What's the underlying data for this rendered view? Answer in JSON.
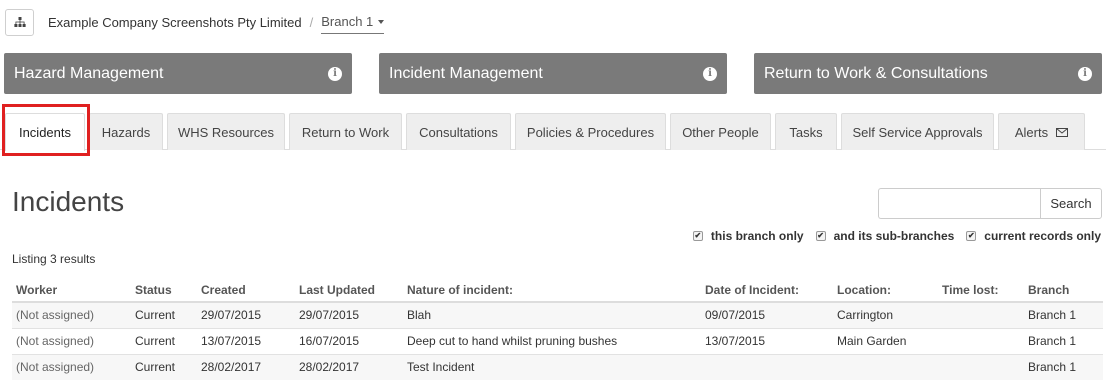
{
  "breadcrumb": {
    "company": "Example Company Screenshots Pty Limited",
    "separator": "/",
    "branch": "Branch 1"
  },
  "modules": [
    {
      "label": "Hazard Management",
      "icon": "info-icon"
    },
    {
      "label": "Incident Management",
      "icon": "info-icon"
    },
    {
      "label": "Return to Work & Consultations",
      "icon": "info-icon"
    }
  ],
  "tabs": [
    {
      "label": "Incidents",
      "active": true
    },
    {
      "label": "Hazards"
    },
    {
      "label": "WHS Resources"
    },
    {
      "label": "Return to Work"
    },
    {
      "label": "Consultations"
    },
    {
      "label": "Policies & Procedures"
    },
    {
      "label": "Other People"
    },
    {
      "label": "Tasks"
    },
    {
      "label": "Self Service Approvals"
    },
    {
      "label": "Alerts",
      "icon": "envelope-icon"
    }
  ],
  "main": {
    "title": "Incidents",
    "search": {
      "placeholder": "",
      "button": "Search"
    },
    "filters": [
      {
        "label": "this branch only",
        "checked": true
      },
      {
        "label": "and its sub-branches",
        "checked": true
      },
      {
        "label": "current records only",
        "checked": true
      }
    ],
    "listing": "Listing 3 results"
  },
  "table": {
    "columns": [
      "Worker",
      "Status",
      "Created",
      "Last Updated",
      "Nature of incident:",
      "Date of Incident:",
      "Location:",
      "Time lost:",
      "Branch"
    ],
    "rows": [
      [
        "(Not assigned)",
        "Current",
        "29/07/2015",
        "29/07/2015",
        "Blah",
        "09/07/2015",
        "Carrington",
        "",
        "Branch 1"
      ],
      [
        "(Not assigned)",
        "Current",
        "13/07/2015",
        "16/07/2015",
        "Deep cut to hand whilst pruning bushes",
        "13/07/2015",
        "Main Garden",
        "",
        "Branch 1"
      ],
      [
        "(Not assigned)",
        "Current",
        "28/02/2017",
        "28/02/2017",
        "Test Incident",
        "",
        "",
        "",
        "Branch 1"
      ]
    ]
  },
  "colors": {
    "module_bg": "#7a7a7a",
    "highlight": "#e02020",
    "tab_bg": "#eeeeee"
  }
}
